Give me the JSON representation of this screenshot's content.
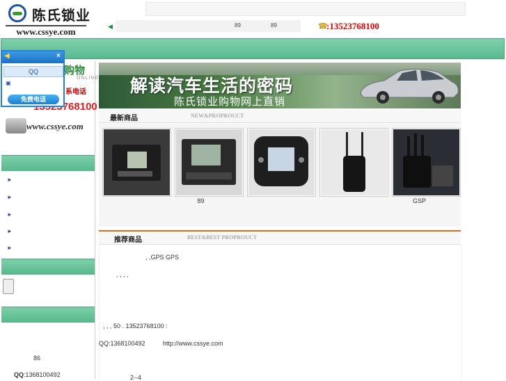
{
  "header": {
    "logo_title": "陈氏锁业",
    "logo_url": "www.cssye.com",
    "marquee_left": "89",
    "marquee_right": "89",
    "phone": ":13523768100"
  },
  "left": {
    "promo_title": "购物",
    "promo_online": "ONLINE",
    "promo_call": "系电话",
    "promo_phone": "13523768100",
    "promo_url": "www.cssye.com",
    "footer_86": "86",
    "footer_qq_label": "QQ",
    "footer_qq": ":1368100492"
  },
  "chat": {
    "qq_label": "QQ",
    "call_label": "免费电话"
  },
  "banner": {
    "title": "解读汽车生活的密码",
    "subtitle": "陈氏锁业购物网上直销"
  },
  "new_products": {
    "title": "最新商品",
    "title_en": "NEW&PROPROUCT",
    "items": [
      {
        "name": ""
      },
      {
        "name": "89"
      },
      {
        "name": ""
      },
      {
        "name": ""
      },
      {
        "name": "GSP"
      }
    ]
  },
  "recommended": {
    "title": "推荐商品",
    "title_en": "BEST&BEST PROPROUCT",
    "line1": ",      ,GPS      GPS",
    "line2": ",          ,                   ,        ,",
    "line3": ",           ,     ,     50         .             13523768100     :",
    "line4_qq": "QQ:1368100492",
    "line4_url": "http://www.cssye.com",
    "line5": "2--4"
  },
  "colors": {
    "nav_green": "#6cc69d",
    "phone_red": "#e30000",
    "rec_orange": "#e26a1a"
  }
}
